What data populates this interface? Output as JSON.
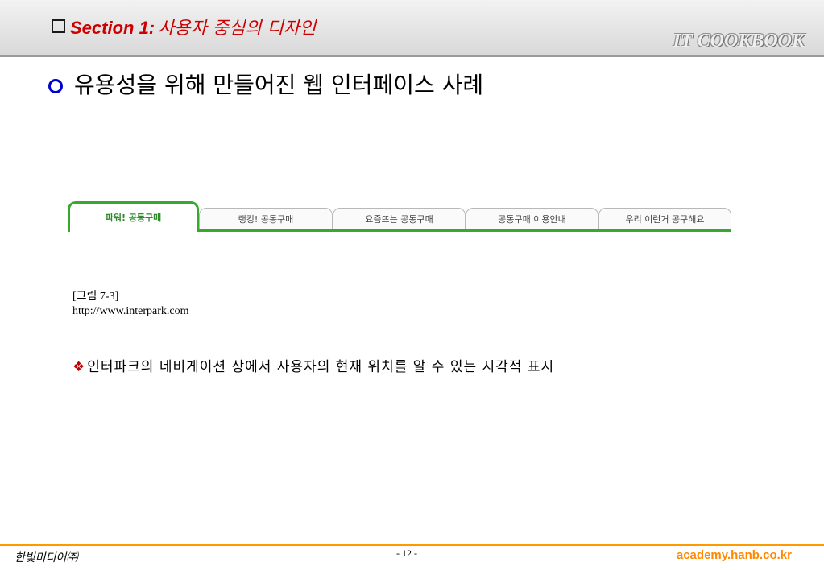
{
  "header": {
    "section_label": "Section 1:",
    "section_subtitle": "사용자 중심의 디자인",
    "brand": "IT COOKBOOK"
  },
  "main": {
    "heading": "유용성을 위해 만들어진 웹 인터페이스 사례"
  },
  "tabs": [
    {
      "label": "파워! 공동구매",
      "active": true
    },
    {
      "label": "랭킹! 공동구매",
      "active": false
    },
    {
      "label": "요즘뜨는 공동구매",
      "active": false
    },
    {
      "label": "공동구매 이용안내",
      "active": false
    },
    {
      "label": "우리 이런거 공구해요",
      "active": false
    }
  ],
  "figure": {
    "caption_line1": "[그림 7-3]",
    "caption_line2": "http://www.interpark.com"
  },
  "description": {
    "bullet_glyph": "❖",
    "text": "인터파크의 네비게이션 상에서 사용자의 현재 위치를 알 수 있는 시각적 표시"
  },
  "footer": {
    "publisher": "한빛미디어㈜",
    "page": "- 12 -",
    "website": "academy.hanb.co.kr"
  },
  "colors": {
    "accent_green": "#39a82f",
    "title_red": "#cc0000",
    "footer_orange": "#ff9900"
  }
}
